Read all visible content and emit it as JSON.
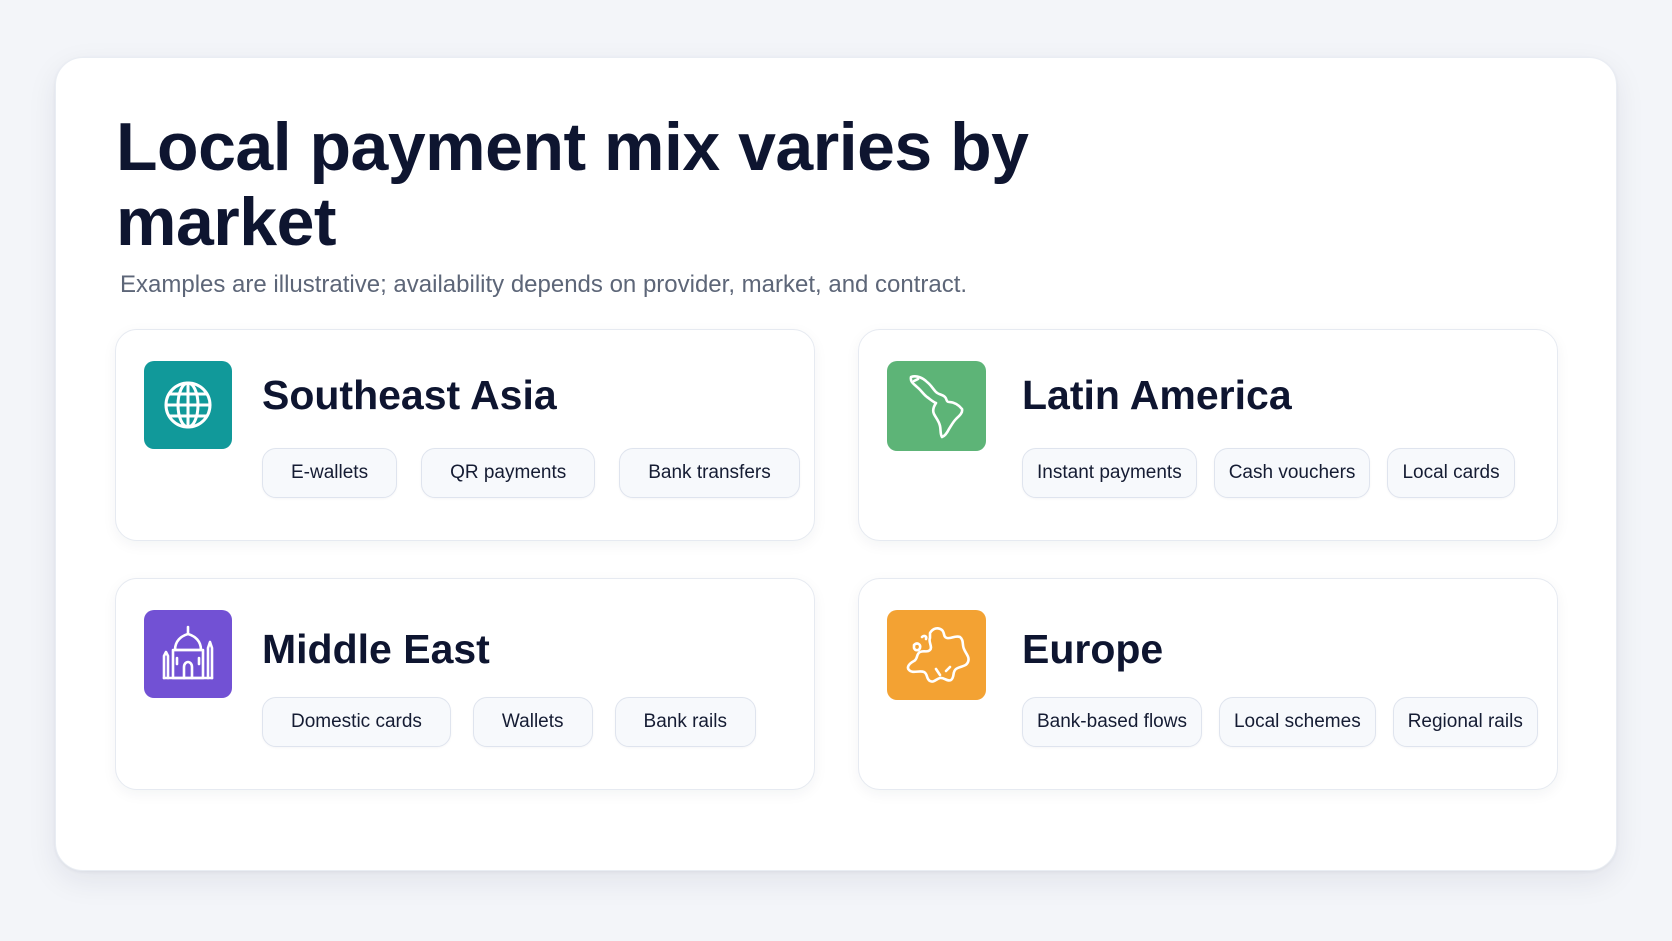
{
  "header": {
    "title": "Local payment mix varies by market",
    "subtitle": "Examples are illustrative; availability depends on provider, market, and contract."
  },
  "colors": {
    "teal": "#11999a",
    "green": "#5db477",
    "purple": "#7251d4",
    "orange": "#f3a233"
  },
  "regions": [
    {
      "name": "Southeast Asia",
      "icon": "globe-icon",
      "chips": [
        "E-wallets",
        "QR payments",
        "Bank transfers"
      ]
    },
    {
      "name": "Latin America",
      "icon": "latin-america-map-icon",
      "chips": [
        "Instant payments",
        "Cash vouchers",
        "Local cards"
      ]
    },
    {
      "name": "Middle East",
      "icon": "mosque-icon",
      "chips": [
        "Domestic cards",
        "Wallets",
        "Bank rails"
      ]
    },
    {
      "name": "Europe",
      "icon": "europe-map-icon",
      "chips": [
        "Bank-based flows",
        "Local schemes",
        "Regional rails"
      ]
    }
  ]
}
